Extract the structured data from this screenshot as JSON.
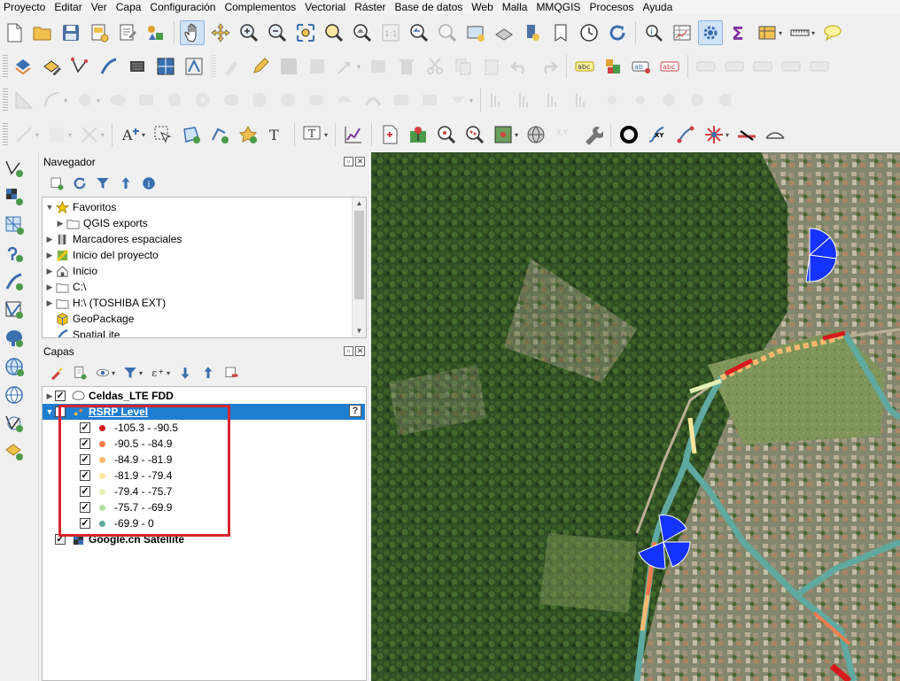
{
  "menubar": [
    "Proyecto",
    "Editar",
    "Ver",
    "Capa",
    "Configuración",
    "Complementos",
    "Vectorial",
    "Ráster",
    "Base de datos",
    "Web",
    "Malla",
    "MMQGIS",
    "Procesos",
    "Ayuda"
  ],
  "navigator": {
    "title": "Navegador",
    "items": [
      {
        "label": "Favoritos",
        "icon": "star-icon",
        "expanded": true,
        "indent": 0
      },
      {
        "label": "QGIS exports",
        "icon": "folder-icon",
        "expanded": false,
        "indent": 1
      },
      {
        "label": "Marcadores espaciales",
        "icon": "bookmark-icon",
        "expanded": false,
        "indent": 0
      },
      {
        "label": "Inicio del proyecto",
        "icon": "project-home-icon",
        "expanded": false,
        "indent": 0
      },
      {
        "label": "Inicio",
        "icon": "home-icon",
        "expanded": false,
        "indent": 0
      },
      {
        "label": "C:\\",
        "icon": "folder-icon",
        "expanded": false,
        "indent": 0
      },
      {
        "label": "H:\\ (TOSHIBA EXT)",
        "icon": "folder-icon",
        "expanded": false,
        "indent": 0
      },
      {
        "label": "GeoPackage",
        "icon": "geopackage-icon",
        "expanded": null,
        "indent": 0
      },
      {
        "label": "SpatiaLite",
        "icon": "spatialite-icon",
        "expanded": null,
        "indent": 0
      }
    ]
  },
  "layers": {
    "title": "Capas",
    "layer1": {
      "name": "Celdas_LTE FDD",
      "checked": true
    },
    "layer2": {
      "name": "RSRP Level",
      "checked": true,
      "selected": true
    },
    "layer3": {
      "name": "Google.cn Satellite",
      "checked": true
    },
    "legend": [
      {
        "label": "-105.3 - -90.5",
        "color": "#d7191c"
      },
      {
        "label": "-90.5 - -84.9",
        "color": "#f07c4a"
      },
      {
        "label": "-84.9 - -81.9",
        "color": "#fdb96e"
      },
      {
        "label": "-81.9 - -79.4",
        "color": "#fee69f"
      },
      {
        "label": "-79.4 - -75.7",
        "color": "#e3f1b4"
      },
      {
        "label": "-75.7 - -69.9",
        "color": "#b3dfa2"
      },
      {
        "label": "-69.9 - 0",
        "color": "#5fa9a1"
      }
    ]
  },
  "highlight_color": "#d8242f"
}
